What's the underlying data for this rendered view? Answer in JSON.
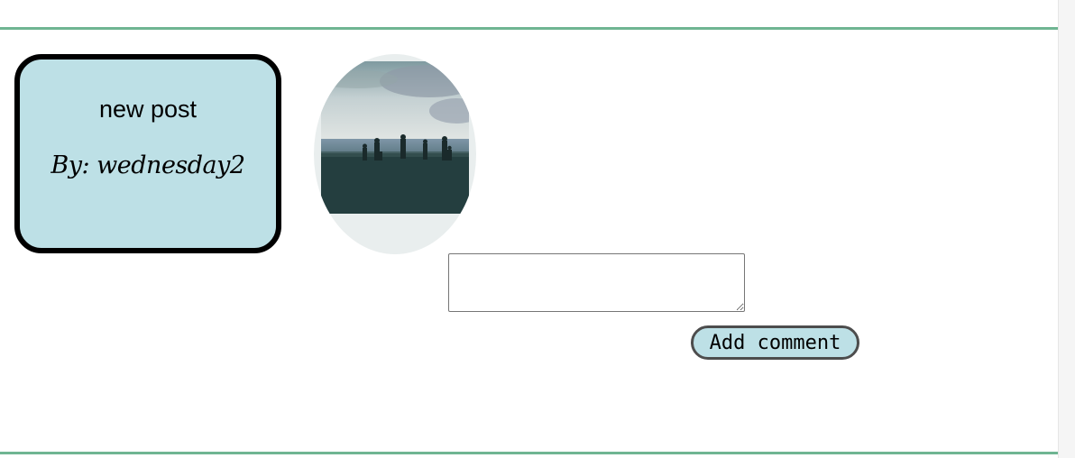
{
  "post": {
    "title": "new post",
    "author": "By: wednesday2",
    "image_icon": "beach-photo-icon"
  },
  "comment": {
    "placeholder": "",
    "value": "",
    "button_label": "Add comment"
  },
  "colors": {
    "card_border": "#6fb592",
    "info_box_bg": "#bde0e6",
    "info_box_border": "#000000",
    "button_bg": "#bde0e6"
  }
}
